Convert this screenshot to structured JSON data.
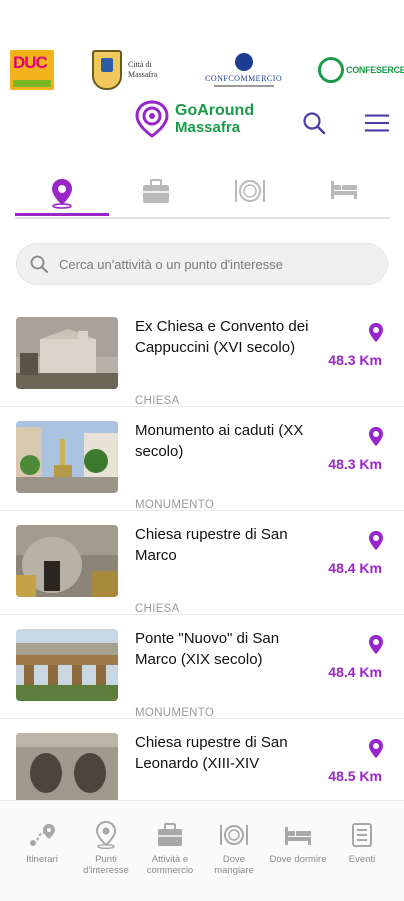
{
  "logos": {
    "duc_label": "DUC",
    "citta_line1": "Città di",
    "citta_line2": "Massafra",
    "confcommercio": "CONFCOMMERCIO",
    "confesercenti": "CONFESERCENTI"
  },
  "brand": {
    "line1": "GoAround",
    "line2": "Massafra"
  },
  "header": {
    "search_icon": "search-icon",
    "menu_icon": "menu-icon"
  },
  "tabs": [
    {
      "icon": "location-pin-icon",
      "active": true
    },
    {
      "icon": "briefcase-icon",
      "active": false
    },
    {
      "icon": "plate-cutlery-icon",
      "active": false
    },
    {
      "icon": "bed-icon",
      "active": false
    }
  ],
  "search": {
    "placeholder": "Cerca un'attività o un punto d'interesse"
  },
  "items": [
    {
      "title": "Ex Chiesa e Convento dei Cappuccini (XVI secolo)",
      "category": "CHIESA",
      "distance": "48.3 Km"
    },
    {
      "title": "Monumento ai caduti (XX secolo)",
      "category": "MONUMENTO",
      "distance": "48.3 Km"
    },
    {
      "title": "Chiesa rupestre di San Marco",
      "category": "CHIESA",
      "distance": "48.4 Km"
    },
    {
      "title": "Ponte \"Nuovo\" di San Marco (XIX secolo)",
      "category": "MONUMENTO",
      "distance": "48.4 Km"
    },
    {
      "title": "Chiesa rupestre di San Leonardo (XIII-XIV",
      "category": "",
      "distance": "48.5 Km"
    }
  ],
  "bottom_nav": [
    {
      "label": "Itinerari",
      "icon": "route-icon"
    },
    {
      "label": "Punti d'interesse",
      "icon": "location-pin-icon"
    },
    {
      "label": "Attività e commercio",
      "icon": "briefcase-icon"
    },
    {
      "label": "Dove mangiare",
      "icon": "plate-cutlery-icon"
    },
    {
      "label": "Dove dormire",
      "icon": "bed-icon"
    },
    {
      "label": "Eventi",
      "icon": "news-icon"
    }
  ],
  "colors": {
    "accent": "#9a26c9",
    "brand_green": "#1b9b4a"
  }
}
